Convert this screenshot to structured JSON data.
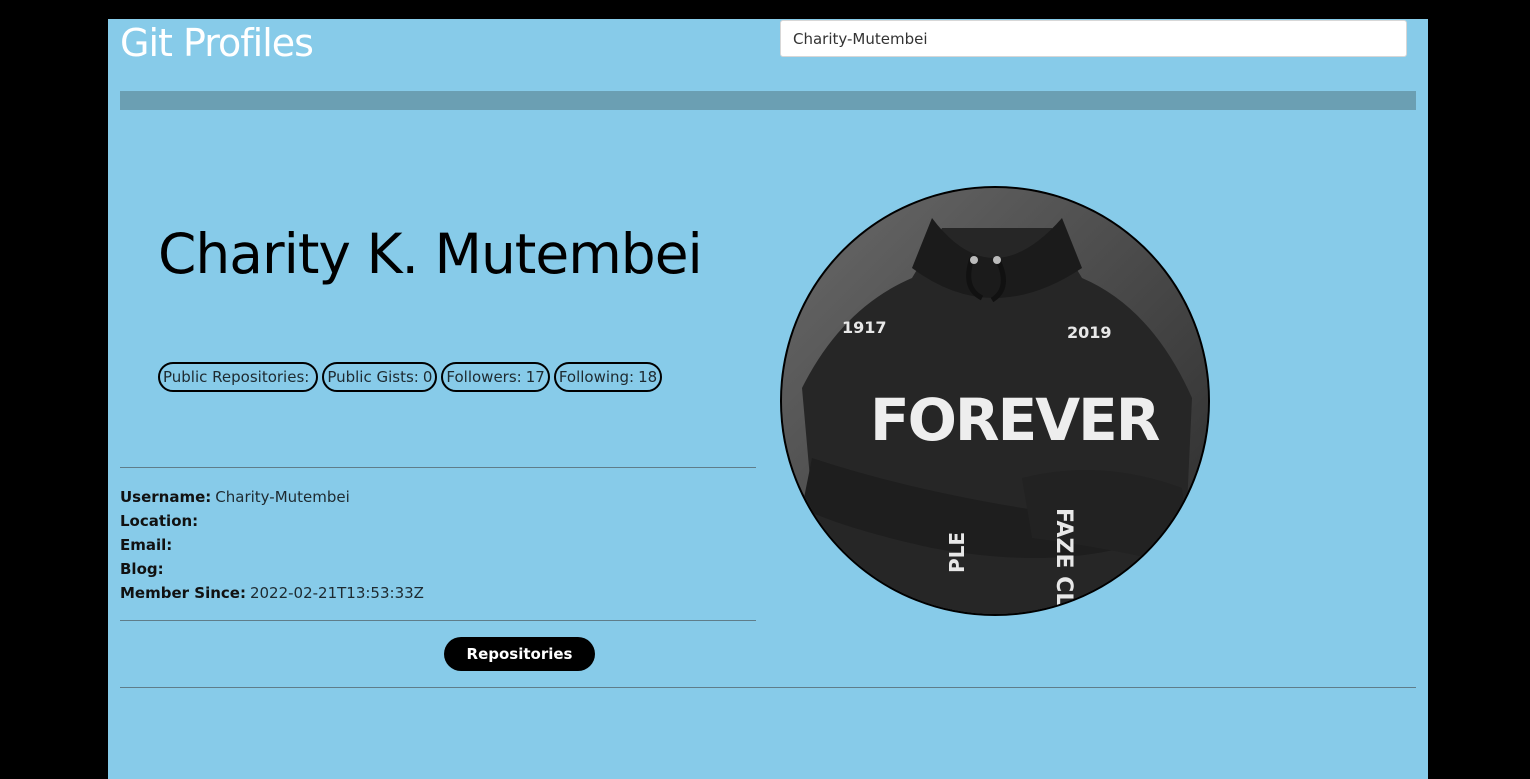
{
  "app": {
    "title": "Git Profiles"
  },
  "search": {
    "value": "Charity-Mutembei"
  },
  "profile": {
    "name": "Charity K. Mutembei",
    "badges": [
      {
        "label": "Public Repositories:",
        "value": ""
      },
      {
        "label": "Public Gists:",
        "value": "0"
      },
      {
        "label": "Followers:",
        "value": "17"
      },
      {
        "label": "Following:",
        "value": "18"
      }
    ],
    "details": [
      {
        "label": "Username:",
        "value": "Charity-Mutembei"
      },
      {
        "label": "Location:",
        "value": ""
      },
      {
        "label": "Email:",
        "value": ""
      },
      {
        "label": "Blog:",
        "value": ""
      },
      {
        "label": "Member Since:",
        "value": "2022-02-21T13:53:33Z"
      }
    ],
    "avatar_text": {
      "year_left": "1917",
      "year_right": "2019",
      "chest": "FOREVER",
      "sleeve": "FAZE CLAN",
      "cuff": "PLE"
    }
  },
  "actions": {
    "repositories_label": "Repositories"
  },
  "colors": {
    "background": "#87CBE9",
    "outer": "#000000",
    "progress": "#6b9fb3",
    "button": "#000000"
  }
}
